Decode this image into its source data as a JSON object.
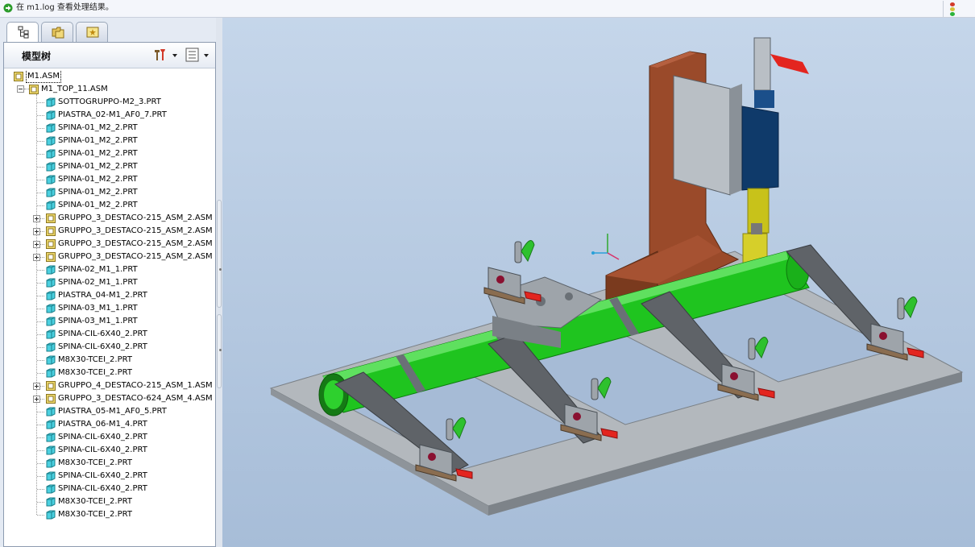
{
  "message_bar": {
    "text": "在 m1.log 查看处理结果。",
    "arrow_icon": "arrow-right-icon",
    "status_icon": "traffic-light-icon"
  },
  "left_panel": {
    "tabs": [
      {
        "name": "model-tree-tab",
        "icon": "model-tree-icon",
        "active": true
      },
      {
        "name": "folder-browser-tab",
        "icon": "folder-icon",
        "active": false
      },
      {
        "name": "favorites-tab",
        "icon": "star-icon",
        "active": false
      }
    ],
    "tree_title": "模型树",
    "settings_icon": "tools-icon",
    "show_icon": "list-icon"
  },
  "tree": {
    "root": "M1.ASM",
    "sub_assembly": "M1_TOP_11.ASM",
    "items": [
      {
        "label": "SOTTOGRUPPO-M2_3.PRT",
        "type": "part",
        "expandable": false
      },
      {
        "label": "PIASTRA_02-M1_AF0_7.PRT",
        "type": "part",
        "expandable": false
      },
      {
        "label": "SPINA-01_M2_2.PRT",
        "type": "part",
        "expandable": false
      },
      {
        "label": "SPINA-01_M2_2.PRT",
        "type": "part",
        "expandable": false
      },
      {
        "label": "SPINA-01_M2_2.PRT",
        "type": "part",
        "expandable": false
      },
      {
        "label": "SPINA-01_M2_2.PRT",
        "type": "part",
        "expandable": false
      },
      {
        "label": "SPINA-01_M2_2.PRT",
        "type": "part",
        "expandable": false
      },
      {
        "label": "SPINA-01_M2_2.PRT",
        "type": "part",
        "expandable": false
      },
      {
        "label": "SPINA-01_M2_2.PRT",
        "type": "part",
        "expandable": false
      },
      {
        "label": "GRUPPO_3_DESTACO-215_ASM_2.ASM",
        "type": "asm",
        "expandable": true
      },
      {
        "label": "GRUPPO_3_DESTACO-215_ASM_2.ASM",
        "type": "asm",
        "expandable": true
      },
      {
        "label": "GRUPPO_3_DESTACO-215_ASM_2.ASM",
        "type": "asm",
        "expandable": true
      },
      {
        "label": "GRUPPO_3_DESTACO-215_ASM_2.ASM",
        "type": "asm",
        "expandable": true
      },
      {
        "label": "SPINA-02_M1_1.PRT",
        "type": "part",
        "expandable": false
      },
      {
        "label": "SPINA-02_M1_1.PRT",
        "type": "part",
        "expandable": false
      },
      {
        "label": "PIASTRA_04-M1_2.PRT",
        "type": "part",
        "expandable": false
      },
      {
        "label": "SPINA-03_M1_1.PRT",
        "type": "part",
        "expandable": false
      },
      {
        "label": "SPINA-03_M1_1.PRT",
        "type": "part",
        "expandable": false
      },
      {
        "label": "SPINA-CIL-6X40_2.PRT",
        "type": "part",
        "expandable": false
      },
      {
        "label": "SPINA-CIL-6X40_2.PRT",
        "type": "part",
        "expandable": false
      },
      {
        "label": "M8X30-TCEI_2.PRT",
        "type": "part",
        "expandable": false
      },
      {
        "label": "M8X30-TCEI_2.PRT",
        "type": "part",
        "expandable": false
      },
      {
        "label": "GRUPPO_4_DESTACO-215_ASM_1.ASM",
        "type": "asm",
        "expandable": true
      },
      {
        "label": "GRUPPO_3_DESTACO-624_ASM_4.ASM",
        "type": "asm",
        "expandable": true
      },
      {
        "label": "PIASTRA_05-M1_AF0_5.PRT",
        "type": "part",
        "expandable": false
      },
      {
        "label": "PIASTRA_06-M1_4.PRT",
        "type": "part",
        "expandable": false
      },
      {
        "label": "SPINA-CIL-6X40_2.PRT",
        "type": "part",
        "expandable": false
      },
      {
        "label": "SPINA-CIL-6X40_2.PRT",
        "type": "part",
        "expandable": false
      },
      {
        "label": "M8X30-TCEI_2.PRT",
        "type": "part",
        "expandable": false
      },
      {
        "label": "SPINA-CIL-6X40_2.PRT",
        "type": "part",
        "expandable": false
      },
      {
        "label": "SPINA-CIL-6X40_2.PRT",
        "type": "part",
        "expandable": false
      },
      {
        "label": "M8X30-TCEI_2.PRT",
        "type": "part",
        "expandable": false
      },
      {
        "label": "M8X30-TCEI_2.PRT",
        "type": "part",
        "expandable": false
      }
    ]
  },
  "viewport": {
    "colors": {
      "plate": "#b3b8bd",
      "tube": "#1fc41f",
      "bracket": "#5f6368",
      "column": "#9a4a2a",
      "clamp_handle": "#e3251f",
      "clamp_lever": "#2ec12e",
      "cylinder": "#0f3a6a",
      "rod": "#c8c21a"
    }
  }
}
